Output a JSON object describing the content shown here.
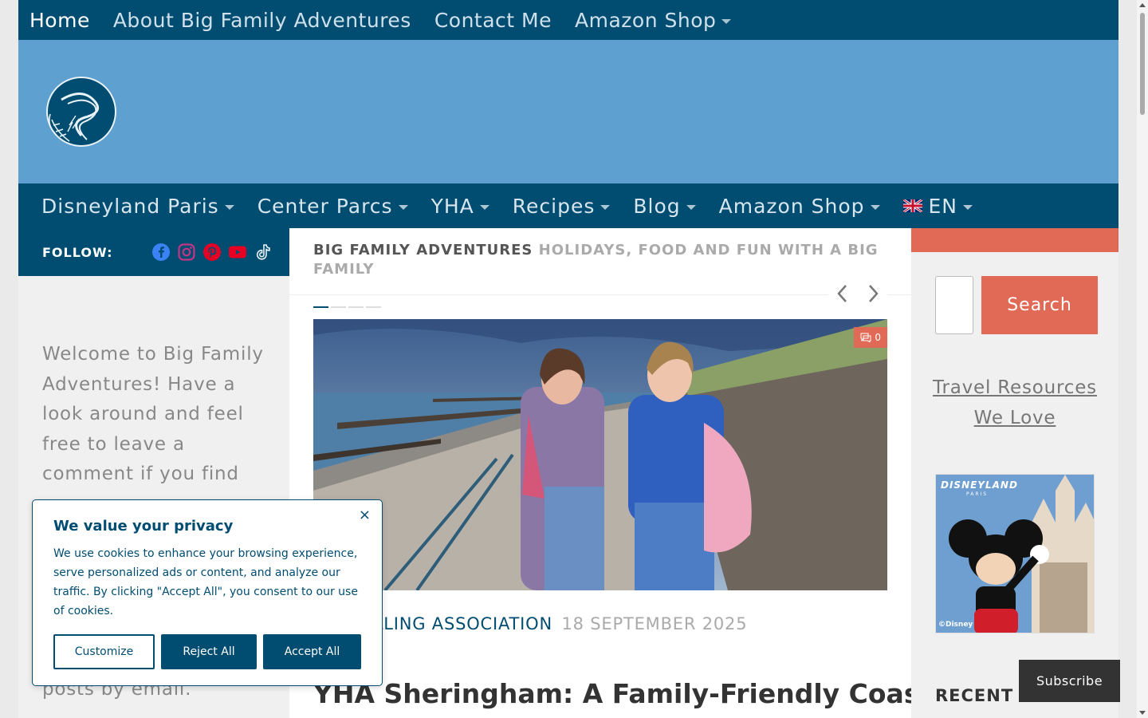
{
  "top_nav": {
    "items": [
      {
        "label": "Home",
        "active": true
      },
      {
        "label": "About Big Family Adventures"
      },
      {
        "label": "Contact Me"
      },
      {
        "label": "Amazon Shop",
        "dropdown": true
      }
    ]
  },
  "main_nav": {
    "items": [
      {
        "label": "Disneyland Paris"
      },
      {
        "label": "Center Parcs"
      },
      {
        "label": "YHA"
      },
      {
        "label": "Recipes"
      },
      {
        "label": "Blog"
      },
      {
        "label": "Amazon Shop"
      },
      {
        "label": "EN"
      }
    ]
  },
  "follow": {
    "label": "FOLLOW:",
    "icons": [
      "facebook-icon",
      "instagram-icon",
      "pinterest-icon",
      "youtube-icon",
      "tiktok-icon"
    ]
  },
  "left_sidebar": {
    "welcome_text": "Welcome to Big Family Adventures! Have a look around and feel free to leave a comment if you find",
    "email_fragment": "posts by email."
  },
  "content": {
    "site_name": "BIG FAMILY ADVENTURES",
    "site_description": "HOLIDAYS, FOOD AND FUN WITH A BIG FAMILY",
    "comment_count": "0",
    "category": "HOSTELLING ASSOCIATION",
    "date": "18 SEPTEMBER 2025",
    "language": "EN",
    "post_title": "YHA Sheringham: A Family-Friendly Coastal"
  },
  "right_sidebar": {
    "search_button": "Search",
    "travel_link": "Travel Resources We Love",
    "ad_brand": "DISNEYLAND",
    "ad_brand_sub": "PARIS",
    "ad_copyright": "©Disney",
    "recent_heading": "RECENT POSTS"
  },
  "subscribe": {
    "label": "Subscribe"
  },
  "cookie_banner": {
    "title": "We value your privacy",
    "body": "We use cookies to enhance your browsing experience, serve personalized ads or content, and analyze our traffic. By clicking \"Accept All\", you consent to our use of cookies.",
    "customize": "Customize",
    "reject": "Reject All",
    "accept": "Accept All",
    "close": "×"
  },
  "colors": {
    "nav_dark": "#004d71",
    "header_blue": "#5ea0d0",
    "accent": "#e06a55"
  }
}
